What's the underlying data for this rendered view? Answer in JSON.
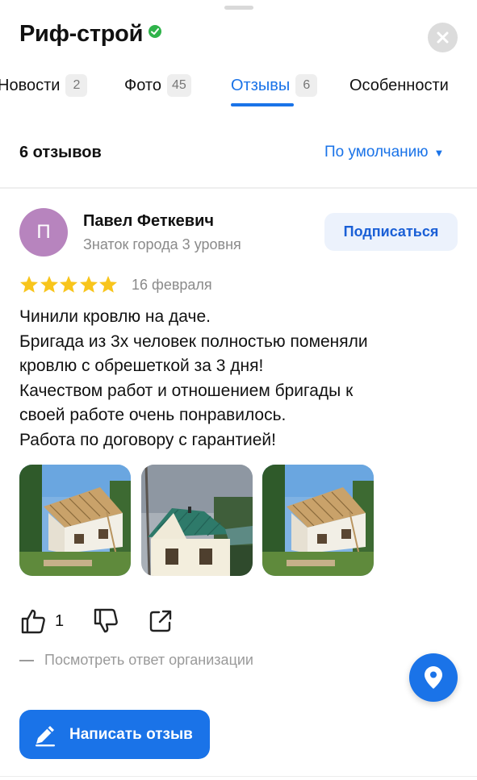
{
  "header": {
    "title": "Риф-строй",
    "verified_icon": "verified-check-icon",
    "close_icon": "close-icon"
  },
  "tabs": [
    {
      "label": "Новости",
      "count": "2",
      "active": false
    },
    {
      "label": "Фото",
      "count": "45",
      "active": false
    },
    {
      "label": "Отзывы",
      "count": "6",
      "active": true
    },
    {
      "label": "Особенности",
      "count": "",
      "active": false
    }
  ],
  "reviews_header": {
    "count_label": "6 отзывов",
    "sort_label": "По умолчанию",
    "sort_caret": "▼"
  },
  "review": {
    "avatar_letter": "П",
    "avatar_color": "#b784be",
    "author_name": "Павел Феткевич",
    "author_level": "Знаток города 3 уровня",
    "subscribe_label": "Подписаться",
    "rating": 5,
    "date": "16 февраля",
    "text_lines": [
      "Чинили кровлю на даче.",
      "Бригада из 3х человек полностью поменяли",
      "кровлю с обрешеткой за 3 дня!",
      "Качеством работ и отношением бригады к",
      "своей работе очень понравилось.",
      "Работа по договору с гарантией!"
    ],
    "photos": [
      "roof-photo-1",
      "roof-photo-2",
      "roof-photo-3"
    ],
    "likes": "1",
    "org_reply_label": "Посмотреть ответ организации"
  },
  "actions": {
    "write_review_label": "Написать отзыв",
    "map_icon": "map-pin-icon"
  },
  "colors": {
    "accent": "#1a73e8",
    "star": "#f8c51c",
    "verified": "#2fb34a"
  }
}
